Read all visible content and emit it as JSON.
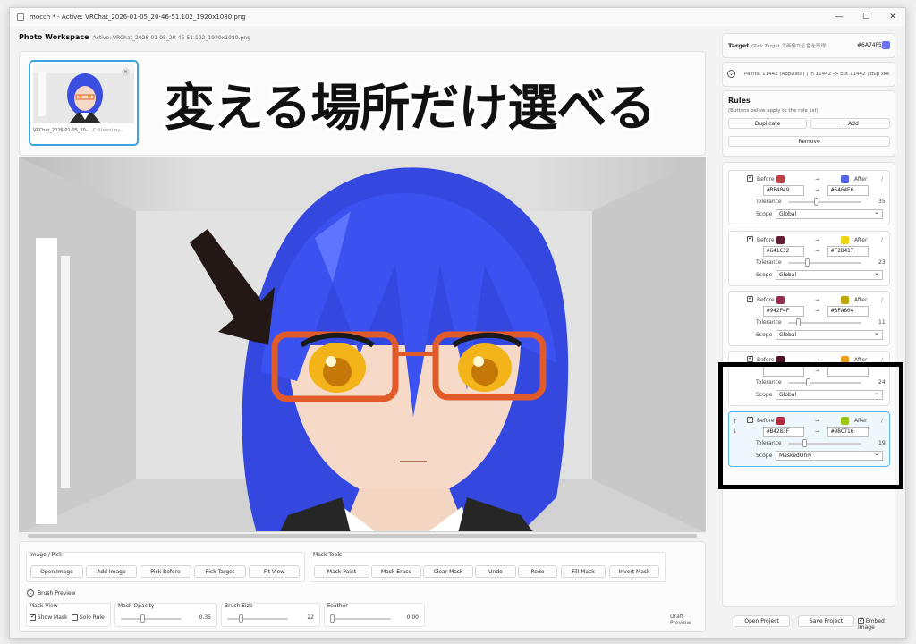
{
  "window": {
    "title": "mocch * - Active: VRChat_2026-01-05_20-46-51.102_1920x1080.png",
    "controls": [
      "—",
      "☐",
      "✕"
    ]
  },
  "workspace": {
    "title": "Photo Workspace",
    "active": "Active: VRChat_2026-01-05_20-46-51.102_1920x1080.png",
    "thumbnail": {
      "name": "VRChat_2026-01-05_20-...",
      "path": "C:\\Users\\my...",
      "close": "×"
    },
    "overlay_text": "変える場所だけ選べる"
  },
  "tools": {
    "image_pick": {
      "label": "Image / Pick",
      "buttons": [
        "Open Image",
        "Add Image",
        "Pick Before",
        "Pick Target",
        "Fit View"
      ]
    },
    "mask_tools": {
      "label": "Mask Tools",
      "buttons": [
        "Mask Paint",
        "Mask Erase",
        "Clear Mask",
        "Undo",
        "Redo",
        "Fill Mask",
        "Invert Mask"
      ]
    },
    "brush_preview_label": "Brush Preview",
    "mask_view": {
      "label": "Mask View",
      "show_mask": "Show Mask",
      "solo_rule": "Solo Rule"
    },
    "mask_opacity": {
      "label": "Mask Opacity",
      "value": "0.35",
      "level": 0.35
    },
    "brush_size": {
      "label": "Brush Size",
      "value": "22",
      "level": 0.2
    },
    "feather": {
      "label": "Feather",
      "value": "0.00",
      "level": 0.0
    },
    "draft_preview": "Draft Preview"
  },
  "right": {
    "target": {
      "label": "Target",
      "hint": "(Pick Target で画像から色を取得)",
      "hex": "#6A74F5",
      "color": "#6A74F5"
    },
    "paints_info": "Paints: 11442 (AppData) | in 11442 -> out 11442 | dup ske",
    "rules_title": "Rules",
    "rules_hint": "(Buttons below apply to the rule list)",
    "duplicate": "Duplicate",
    "add": "+ Add",
    "remove": "Remove",
    "before_label": "Before",
    "after_label": "After",
    "arrow": "→",
    "tolerance_label": "Tolerance",
    "scope_label": "Scope",
    "rules": [
      {
        "before": "#BF4049",
        "after": "#5464E6",
        "before_color": "#BF4049",
        "after_color": "#5464E6",
        "tolerance": "35",
        "scope": "Global"
      },
      {
        "before": "#641C32",
        "after": "#F2D417",
        "before_color": "#641C32",
        "after_color": "#F2D417",
        "tolerance": "23",
        "scope": "Global"
      },
      {
        "before": "#942F4F",
        "after": "#BFA604",
        "before_color": "#942F4F",
        "after_color": "#BFA604",
        "tolerance": "11",
        "scope": "Global"
      },
      {
        "before": "",
        "after": "",
        "before_color": "#4A1025",
        "after_color": "#F0A020",
        "tolerance": "24",
        "scope": "Global"
      },
      {
        "before": "#B4283F",
        "after": "#9BC716",
        "before_color": "#B4283F",
        "after_color": "#9BC716",
        "tolerance": "19",
        "scope": "MaskedOnly"
      }
    ],
    "open_project": "Open Project",
    "save_project": "Save Project",
    "embed_image": "Embed Image"
  }
}
